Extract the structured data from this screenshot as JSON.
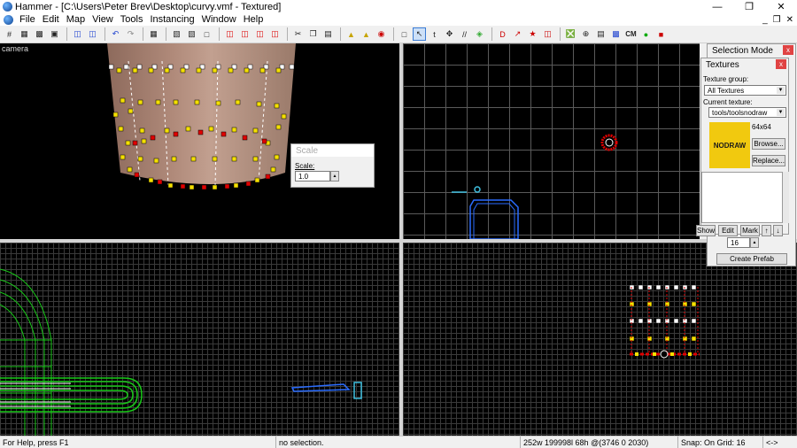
{
  "app": {
    "title": "Hammer - [C:\\Users\\Peter Brev\\Desktop\\curvy.vmf - Textured]"
  },
  "menu": [
    "File",
    "Edit",
    "Map",
    "View",
    "Tools",
    "Instancing",
    "Window",
    "Help"
  ],
  "viewports": {
    "camera_label": "camera"
  },
  "scale_dialog": {
    "title": "Scale",
    "label": "Scale:",
    "value": "1.0"
  },
  "selection_mode": {
    "title": "Selection Mode"
  },
  "textures": {
    "title": "Textures",
    "group_label": "Texture group:",
    "group_value": "All Textures",
    "current_label": "Current texture:",
    "current_value": "tools/toolsnodraw",
    "preview_text": "NODRAW",
    "size": "64x64",
    "browse": "Browse...",
    "replace": "Replace...",
    "show": "Show",
    "edit": "Edit",
    "mark": "Mark",
    "up": "↑",
    "down": "↓"
  },
  "prefab": {
    "value": "16",
    "button": "Create Prefab"
  },
  "status": {
    "help": "For Help, press F1",
    "selection": "no selection.",
    "coords": "252w 199998l 68h @(3746 0 2030)",
    "snap": "Snap: On Grid: 16",
    "arrows": "<->"
  },
  "colors": {
    "vertex": "#f5e000",
    "handle_red": "#e00000",
    "handle_white": "#ffffff",
    "solid_green": "#18c918",
    "solid_blue": "#2a6cff",
    "texture_yellow": "#f1c90f"
  }
}
